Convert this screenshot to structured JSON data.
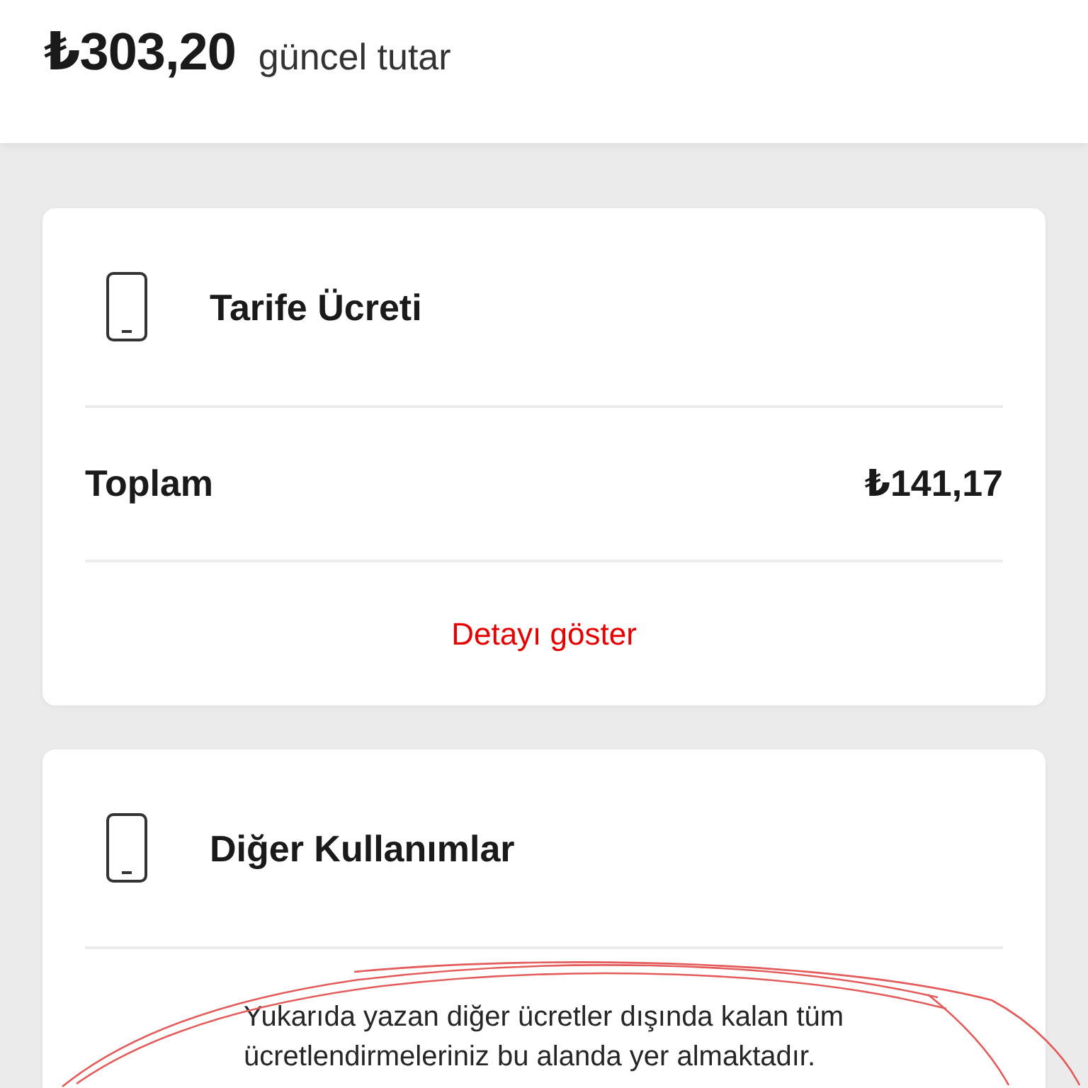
{
  "header": {
    "amount": "₺303,20",
    "label": "güncel tutar"
  },
  "cards": [
    {
      "kind": "summary",
      "title": "Tarife Ücreti",
      "total_label": "Toplam",
      "total_value": "₺141,17",
      "link": "Detayı göster"
    },
    {
      "kind": "note",
      "title": "Diğer Kullanımlar",
      "note": "Yukarıda yazan diğer ücretler dışında kalan tüm ücretlendirmeleriniz bu alanda yer almaktadır.",
      "circled": true
    }
  ]
}
